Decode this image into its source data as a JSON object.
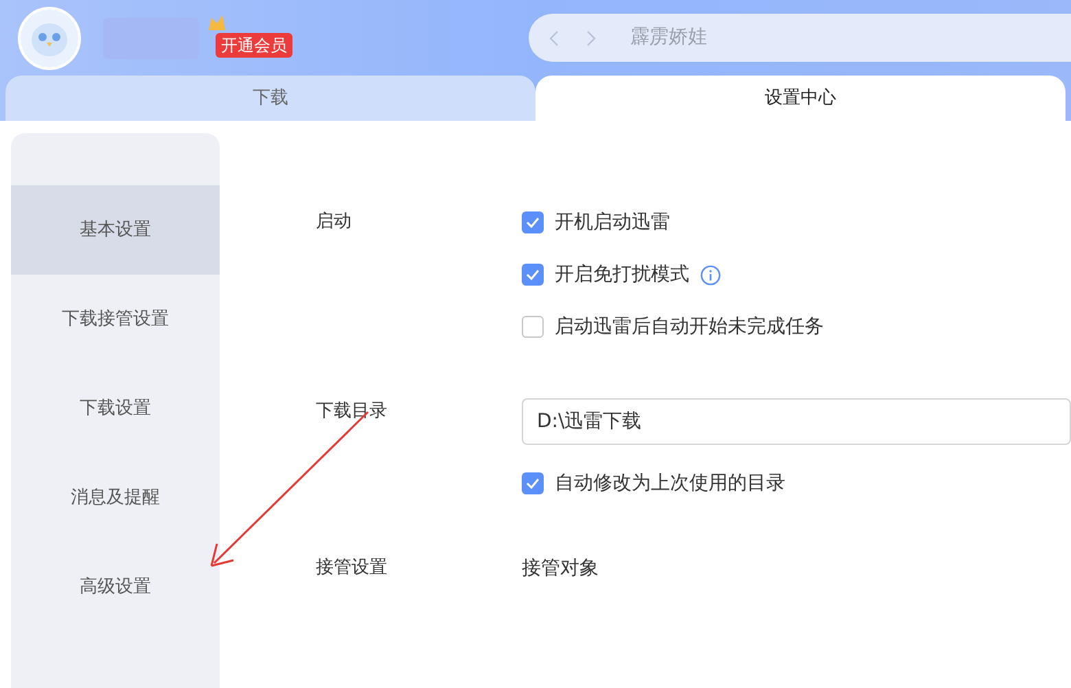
{
  "header": {
    "vip_badge": "开通会员",
    "search": {
      "placeholder": "霹雳娇娃"
    }
  },
  "tabs": [
    {
      "label": "下载",
      "selected": false
    },
    {
      "label": "设置中心",
      "selected": true
    }
  ],
  "sidebar": {
    "items": [
      {
        "label": "基本设置",
        "selected": true
      },
      {
        "label": "下载接管设置",
        "selected": false
      },
      {
        "label": "下载设置",
        "selected": false
      },
      {
        "label": "消息及提醒",
        "selected": false
      },
      {
        "label": "高级设置",
        "selected": false
      }
    ]
  },
  "sections": [
    {
      "label": "启动",
      "options": [
        {
          "kind": "checkbox",
          "label": "开机启动迅雷",
          "checked": true,
          "info": false
        },
        {
          "kind": "checkbox",
          "label": "开启免打扰模式",
          "checked": true,
          "info": true
        },
        {
          "kind": "checkbox",
          "label": "启动迅雷后自动开始未完成任务",
          "checked": false,
          "info": false
        }
      ]
    },
    {
      "label": "下载目录",
      "options": [
        {
          "kind": "field",
          "value": "D:\\迅雷下载"
        },
        {
          "kind": "checkbox",
          "label": "自动修改为上次使用的目录",
          "checked": true,
          "info": false
        }
      ]
    },
    {
      "label": "接管设置",
      "options": [
        {
          "kind": "text",
          "label": "接管对象"
        }
      ]
    }
  ]
}
